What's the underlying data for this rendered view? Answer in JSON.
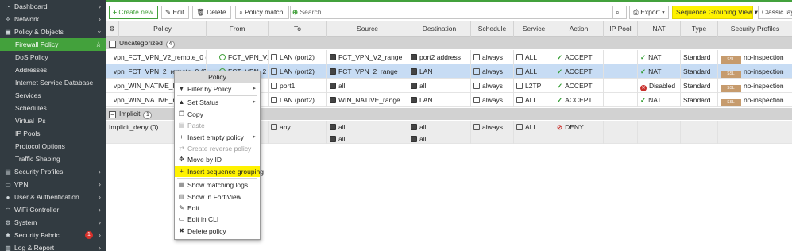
{
  "sidebar": {
    "items": [
      {
        "label": "Dashboard",
        "icon": "dashboard-icon",
        "glyph": "◔"
      },
      {
        "label": "Network",
        "icon": "network-icon",
        "glyph": "✣"
      },
      {
        "label": "Policy & Objects",
        "icon": "policy-objects-icon",
        "glyph": "▣"
      },
      {
        "label": "Firewall Policy"
      },
      {
        "label": "DoS Policy"
      },
      {
        "label": "Addresses"
      },
      {
        "label": "Internet Service Database"
      },
      {
        "label": "Services"
      },
      {
        "label": "Schedules"
      },
      {
        "label": "Virtual IPs"
      },
      {
        "label": "IP Pools"
      },
      {
        "label": "Protocol Options"
      },
      {
        "label": "Traffic Shaping"
      },
      {
        "label": "Security Profiles",
        "icon": "security-profiles-icon",
        "glyph": "▤"
      },
      {
        "label": "VPN",
        "icon": "vpn-icon",
        "glyph": "▭"
      },
      {
        "label": "User & Authentication",
        "icon": "user-icon",
        "glyph": "●"
      },
      {
        "label": "WiFi Controller",
        "icon": "wifi-icon",
        "glyph": "◠"
      },
      {
        "label": "System",
        "icon": "system-icon",
        "glyph": "⚙"
      },
      {
        "label": "Security Fabric",
        "icon": "security-fabric-icon",
        "glyph": "✱",
        "badge": "1"
      },
      {
        "label": "Log & Report",
        "icon": "log-report-icon",
        "glyph": "▥"
      }
    ]
  },
  "toolbar": {
    "create_new": "Create new",
    "edit": "Edit",
    "delete": "Delete",
    "policy_match": "Policy match",
    "search_placeholder": "Search",
    "export": "Export",
    "sequence_grouping_view": "Sequence Grouping View",
    "classic_layout": "Classic layout"
  },
  "table": {
    "columns": [
      "Policy",
      "From",
      "To",
      "Source",
      "Destination",
      "Schedule",
      "Service",
      "Action",
      "IP Pool",
      "NAT",
      "Type",
      "Security Profiles"
    ],
    "groups": [
      {
        "name": "Uncategorized",
        "count": "4",
        "rows": [
          {
            "policy": "vpn_FCT_VPN_V2_remote_0 (1)",
            "from": "FCT_VPN_V2",
            "to": "LAN (port2)",
            "source": "FCT_VPN_V2_range",
            "destination": "port2 address",
            "schedule": "always",
            "service": "ALL",
            "action": "ACCEPT",
            "ip_pool": "",
            "nat": "NAT",
            "type": "Standard",
            "security_profile": "no-inspection",
            "security_badge": "SSL"
          },
          {
            "policy": "vpn_FCT_VPN_2_remote_0 (2)",
            "from": "FCT_VPN_2",
            "to": "LAN (port2)",
            "source": "FCT_VPN_2_range",
            "destination": "LAN",
            "schedule": "always",
            "service": "ALL",
            "action": "ACCEPT",
            "ip_pool": "",
            "nat": "NAT",
            "type": "Standard",
            "security_profile": "no-inspection",
            "security_badge": "SSL"
          },
          {
            "policy": "vpn_WIN_NATIVE_l2tp",
            "from": "",
            "to": "port1",
            "source": "all",
            "destination": "all",
            "schedule": "always",
            "service": "L2TP",
            "action": "ACCEPT",
            "ip_pool": "",
            "nat": "Disabled",
            "type": "Standard",
            "security_profile": "no-inspection",
            "security_badge": "SSL"
          },
          {
            "policy": "vpn_WIN_NATIVE_remote",
            "from": "",
            "to": "LAN (port2)",
            "source": "WIN_NATIVE_range",
            "destination": "LAN",
            "schedule": "always",
            "service": "ALL",
            "action": "ACCEPT",
            "ip_pool": "",
            "nat": "NAT",
            "type": "Standard",
            "security_profile": "no-inspection",
            "security_badge": "SSL"
          }
        ]
      },
      {
        "name": "Implicit",
        "count": "1",
        "rows": [
          {
            "policy": "Implicit_deny (0)",
            "from": "",
            "to": "any",
            "source": "all",
            "source2": "all",
            "destination": "all",
            "destination2": "all",
            "schedule": "always",
            "service": "ALL",
            "action": "DENY"
          }
        ]
      }
    ]
  },
  "context_menu": {
    "title": "Policy",
    "items": [
      {
        "label": "Filter by Policy",
        "icon": "filter-icon",
        "glyph": "▼",
        "submenu": true
      },
      {
        "separator": true
      },
      {
        "label": "Set Status",
        "icon": "status-icon",
        "glyph": "▲",
        "submenu": true
      },
      {
        "label": "Copy",
        "icon": "copy-icon",
        "glyph": "❐"
      },
      {
        "label": "Paste",
        "icon": "paste-icon",
        "glyph": "▤",
        "disabled": true
      },
      {
        "label": "Insert empty policy",
        "icon": "insert-icon",
        "glyph": "+",
        "submenu": true
      },
      {
        "label": "Create reverse policy",
        "icon": "reverse-icon",
        "glyph": "⇄",
        "disabled": true
      },
      {
        "label": "Move by ID",
        "icon": "move-icon",
        "glyph": "✥"
      },
      {
        "label": "Insert sequence grouping",
        "icon": "plus-icon",
        "glyph": "+",
        "highlight": true
      },
      {
        "separator": true
      },
      {
        "label": "Show matching logs",
        "icon": "logs-icon",
        "glyph": "▤"
      },
      {
        "label": "Show in FortiView",
        "icon": "fortiview-icon",
        "glyph": "▥"
      },
      {
        "label": "Edit",
        "icon": "edit-icon",
        "glyph": "✎"
      },
      {
        "label": "Edit in CLI",
        "icon": "cli-icon",
        "glyph": "▭"
      },
      {
        "label": "Delete policy",
        "icon": "trash-icon",
        "glyph": "✖"
      }
    ]
  }
}
